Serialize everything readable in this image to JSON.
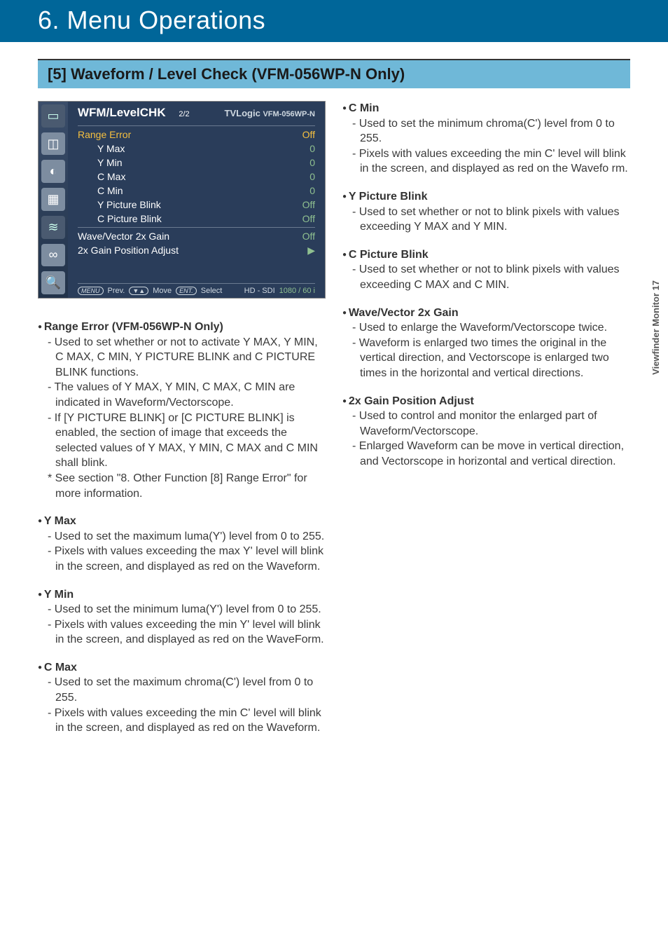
{
  "chapter_title": "6. Menu Operations",
  "section_title": "[5] Waveform / Level Check (VFM-056WP-N Only)",
  "side_label": "Viewfinder Monitor  17",
  "menu": {
    "title_left": "WFM/LevelCHK",
    "title_page": "2/2",
    "title_brand": "TVLogic",
    "title_model": "VFM-056WP-N",
    "items": [
      {
        "k": "Range Error",
        "v": "Off",
        "highlight": true,
        "indent": false
      },
      {
        "k": "Y Max",
        "v": "0",
        "highlight": false,
        "indent": true
      },
      {
        "k": "Y Min",
        "v": "0",
        "highlight": false,
        "indent": true
      },
      {
        "k": "C Max",
        "v": "0",
        "highlight": false,
        "indent": true
      },
      {
        "k": "C Min",
        "v": "0",
        "highlight": false,
        "indent": true
      },
      {
        "k": "Y Picture Blink",
        "v": "Off",
        "highlight": false,
        "indent": true
      },
      {
        "k": "C Picture Blink",
        "v": "Off",
        "highlight": false,
        "indent": true
      }
    ],
    "items2": [
      {
        "k": "Wave/Vector 2x Gain",
        "v": "Off"
      },
      {
        "k": "2x Gain Position Adjust",
        "v": "▶"
      }
    ],
    "foot": {
      "menu_btn": "MENU",
      "prev": "Prev.",
      "arrows": "▼▲",
      "move": "Move",
      "ent_btn": "ENT.",
      "select": "Select",
      "signal": "HD - SDI",
      "res": "1080 / 60 i"
    }
  },
  "icons": [
    "monitor-icon",
    "crop-icon",
    "adjust-icon",
    "camera-icon",
    "waveform-icon",
    "link-icon",
    "search-icon"
  ],
  "left_items": [
    {
      "head": "Range Error (VFM-056WP-N Only)",
      "subs": [
        "- Used to set whether or not to activate Y MAX, Y MIN, C MAX, C MIN, Y PICTURE BLINK and C PICTURE BLINK functions.",
        "- The values of Y MAX, Y MIN, C MAX, C MIN are indicated in Waveform/Vectorscope.",
        "- If [Y PICTURE BLINK] or [C PICTURE BLINK] is enabled, the section of image that exceeds the selected values of Y MAX, Y MIN, C MAX and C MIN shall blink."
      ],
      "note": "* See section \"8. Other Function [8] Range Error\" for more information."
    },
    {
      "head": "Y Max",
      "subs": [
        "- Used to set the maximum luma(Y') level from 0 to 255.",
        "- Pixels with values exceeding the max Y' level will blink in the screen, and displayed as red on the Waveform."
      ]
    },
    {
      "head": "Y Min",
      "subs": [
        "- Used to set the minimum luma(Y') level from 0 to 255.",
        "- Pixels with values exceeding the min Y' level will blink in the screen, and displayed as red on the WaveForm."
      ]
    },
    {
      "head": "C Max",
      "subs": [
        "- Used to set the maximum chroma(C') level from 0 to 255.",
        "- Pixels with values exceeding the min C' level will blink in the screen, and displayed as red on the Waveform."
      ]
    }
  ],
  "right_items": [
    {
      "head": "C Min",
      "subs": [
        "- Used to set the minimum chroma(C') level from 0 to 255.",
        "- Pixels with values exceeding the min C' level will blink in the screen, and displayed as red on the Wavefo rm."
      ]
    },
    {
      "head": "Y Picture Blink",
      "subs": [
        "- Used to set whether or not to blink pixels with values exceeding Y MAX and Y MIN."
      ]
    },
    {
      "head": "C Picture Blink",
      "subs": [
        "- Used to set whether or not to blink pixels with values exceeding C MAX and C MIN."
      ]
    },
    {
      "head": "Wave/Vector 2x Gain",
      "subs": [
        "- Used to enlarge the Waveform/Vectorscope twice.",
        "- Waveform is enlarged two times the original in the vertical direction, and Vectorscope is enlarged two times in the horizontal and vertical directions."
      ]
    },
    {
      "head": "2x Gain Position Adjust",
      "subs": [
        "- Used to control and monitor the enlarged part of Waveform/Vectorscope.",
        "- Enlarged Waveform can be move in vertical direction, and Vectorscope in horizontal and vertical direction."
      ]
    }
  ]
}
